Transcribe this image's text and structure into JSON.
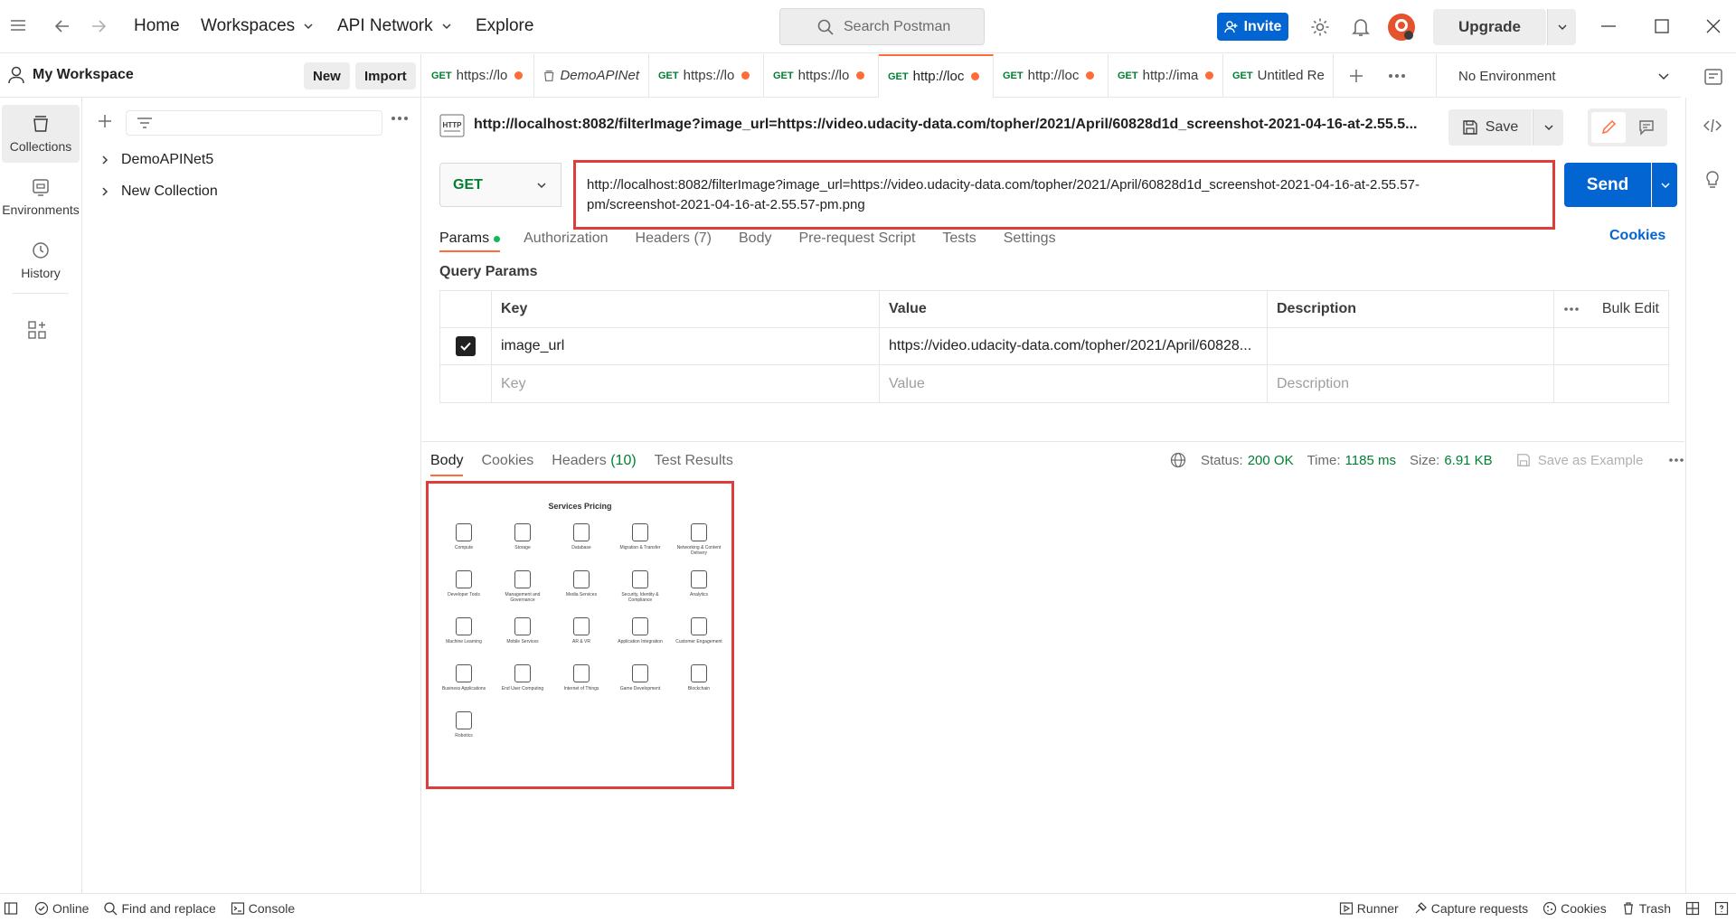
{
  "nav": {
    "home": "Home",
    "workspaces": "Workspaces",
    "api_network": "API Network",
    "explore": "Explore",
    "search_placeholder": "Search Postman",
    "invite": "Invite",
    "upgrade": "Upgrade"
  },
  "workspace": {
    "name": "My Workspace",
    "new_label": "New",
    "import_label": "Import"
  },
  "rail": [
    {
      "label": "Collections",
      "icon": "collections-icon"
    },
    {
      "label": "Environments",
      "icon": "environments-icon"
    },
    {
      "label": "History",
      "icon": "history-icon"
    }
  ],
  "collections": [
    "DemoAPINet5",
    "New Collection"
  ],
  "tabs": [
    {
      "method": "GET",
      "label": "https://lo",
      "dirty": true
    },
    {
      "method": "",
      "label": "DemoAPINet",
      "dirty": false,
      "italic": true
    },
    {
      "method": "GET",
      "label": "https://lo",
      "dirty": true
    },
    {
      "method": "GET",
      "label": "https://lo",
      "dirty": true
    },
    {
      "method": "GET",
      "label": "http://loc",
      "dirty": true,
      "active": true
    },
    {
      "method": "GET",
      "label": "http://loc",
      "dirty": true
    },
    {
      "method": "GET",
      "label": "http://ima",
      "dirty": true
    },
    {
      "method": "GET",
      "label": "Untitled Re",
      "dirty": false
    }
  ],
  "environment": "No Environment",
  "request": {
    "title_url": "http://localhost:8082/filterImage?image_url=https://video.udacity-data.com/topher/2021/April/60828d1d_screenshot-2021-04-16-at-2.55.5...",
    "save_label": "Save",
    "method": "GET",
    "url_line1": "http://localhost:8082/filterImage?image_url=https://video.udacity-data.com/topher/2021/April/60828d1d_screenshot-2021-04-16-at-2.55.57-",
    "url_line2": "pm/screenshot-2021-04-16-at-2.55.57-pm.png",
    "send_label": "Send",
    "tabs": [
      "Params",
      "Authorization",
      "Headers (7)",
      "Body",
      "Pre-request Script",
      "Tests",
      "Settings"
    ],
    "cookies_label": "Cookies",
    "query_params_label": "Query Params"
  },
  "params_table": {
    "headers": [
      "Key",
      "Value",
      "Description"
    ],
    "bulk_edit": "Bulk Edit",
    "rows": [
      {
        "checked": true,
        "key": "image_url",
        "value": "https://video.udacity-data.com/topher/2021/April/60828...",
        "description": ""
      }
    ],
    "placeholders": {
      "key": "Key",
      "value": "Value",
      "description": "Description"
    }
  },
  "response": {
    "tabs": [
      "Body",
      "Cookies",
      "Headers",
      "Test Results"
    ],
    "headers_count": "(10)",
    "status_label": "Status:",
    "status_value": "200 OK",
    "time_label": "Time:",
    "time_value": "1185 ms",
    "size_label": "Size:",
    "size_value": "6.91 KB",
    "save_example": "Save as Example",
    "image": {
      "title": "Services Pricing",
      "items": [
        "Compute",
        "Storage",
        "Database",
        "Migration & Transfer",
        "Networking & Content Delivery",
        "Developer Tools",
        "Management and Governance",
        "Media Services",
        "Security, Identity & Compliance",
        "Analytics",
        "Machine Learning",
        "Mobile Services",
        "AR & VR",
        "Application Integration",
        "Customer Engagement",
        "Business Applications",
        "End User Computing",
        "Internet of Things",
        "Game Development",
        "Blockchain",
        "Robotics"
      ]
    }
  },
  "statusbar": {
    "online": "Online",
    "find_replace": "Find and replace",
    "console": "Console",
    "runner": "Runner",
    "capture": "Capture requests",
    "cookies": "Cookies",
    "trash": "Trash"
  },
  "colors": {
    "accent": "#ff6c37",
    "primary": "#0265d2",
    "success": "#007f31",
    "highlight": "#e03c3c"
  }
}
